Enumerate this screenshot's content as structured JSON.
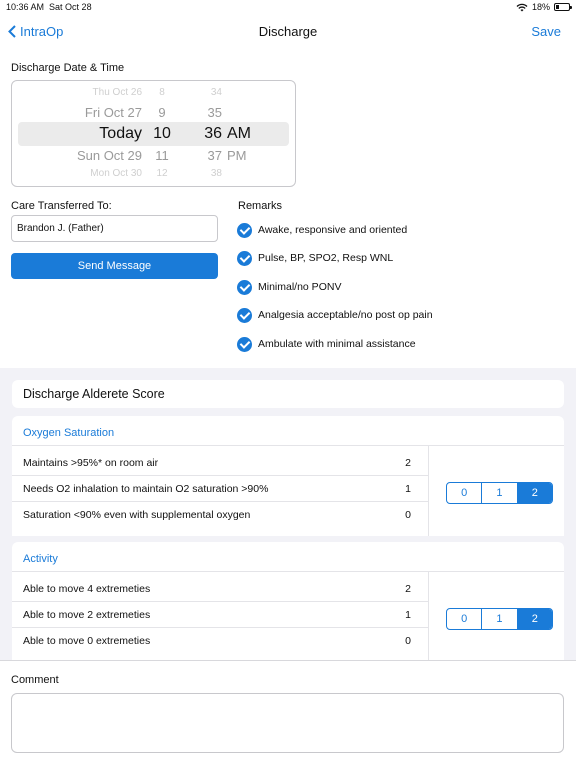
{
  "status": {
    "time": "10:36 AM",
    "date": "Sat Oct 28",
    "battery": "18%"
  },
  "nav": {
    "back_label": "IntraOp",
    "title": "Discharge",
    "save_label": "Save"
  },
  "discharge": {
    "label": "Discharge Date & Time",
    "picker_rows": [
      {
        "day": "Thu Oct 26",
        "hour": "8",
        "minute": "34",
        "ampm": ""
      },
      {
        "day": "Fri Oct 27",
        "hour": "9",
        "minute": "35",
        "ampm": ""
      },
      {
        "day": "Today",
        "hour": "10",
        "minute": "36",
        "ampm": "AM"
      },
      {
        "day": "Sun Oct 29",
        "hour": "11",
        "minute": "37",
        "ampm": "PM"
      },
      {
        "day": "Mon Oct 30",
        "hour": "12",
        "minute": "38",
        "ampm": ""
      }
    ]
  },
  "care": {
    "label": "Care Transferred To:",
    "value": "Brandon J. (Father)",
    "send_label": "Send Message"
  },
  "remarks": {
    "label": "Remarks",
    "items": [
      "Awake, responsive and oriented",
      "Pulse, BP, SPO2, Resp WNL",
      "Minimal/no PONV",
      "Analgesia acceptable/no post op pain",
      "Ambulate with minimal assistance"
    ]
  },
  "score": {
    "title": "Discharge Alderete Score",
    "groups": [
      {
        "name": "Oxygen Saturation",
        "options": [
          {
            "label": "Maintains >95%* on room air",
            "value": "2"
          },
          {
            "label": "Needs O2 inhalation to maintain O2 saturation >90%",
            "value": "1"
          },
          {
            "label": "Saturation <90% even with supplemental oxygen",
            "value": "0"
          }
        ],
        "segments": [
          "0",
          "1",
          "2"
        ],
        "selected": "2"
      },
      {
        "name": "Activity",
        "options": [
          {
            "label": "Able to move 4 extremeties",
            "value": "2"
          },
          {
            "label": "Able to move 2 extremeties",
            "value": "1"
          },
          {
            "label": "Able to move 0 extremeties",
            "value": "0"
          }
        ],
        "segments": [
          "0",
          "1",
          "2"
        ],
        "selected": "2"
      }
    ]
  },
  "comment": {
    "label": "Comment",
    "value": ""
  }
}
